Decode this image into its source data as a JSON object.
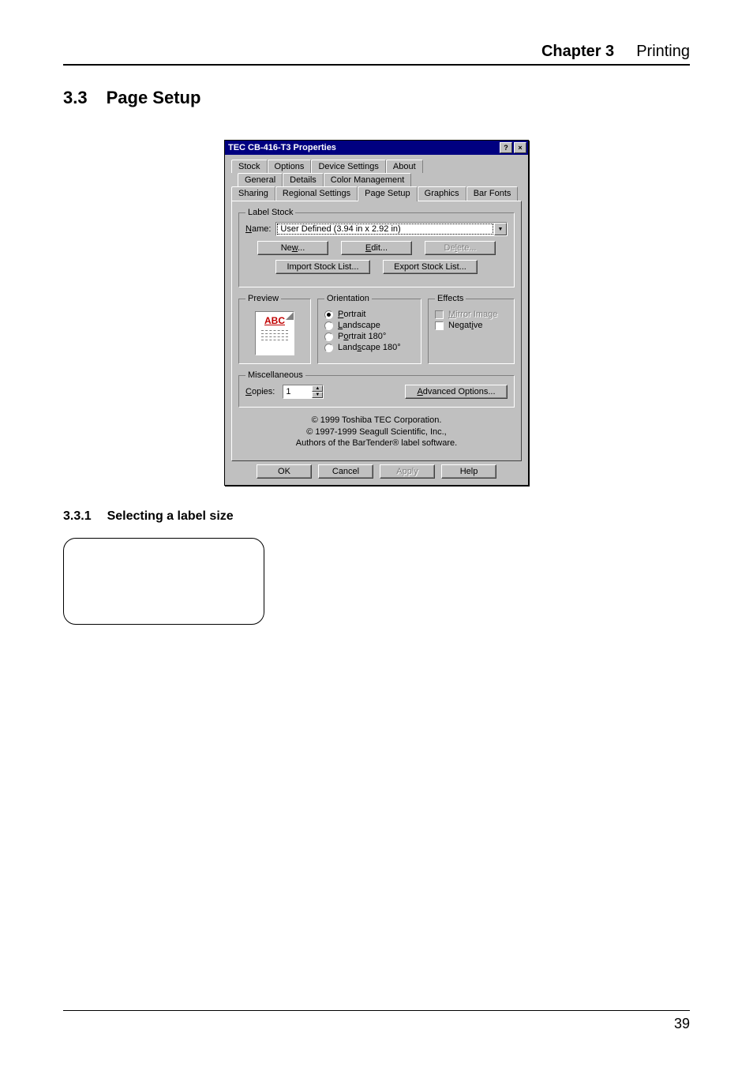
{
  "header": {
    "chapter": "Chapter 3",
    "subject": "Printing"
  },
  "section": {
    "number": "3.3",
    "title": "Page Setup"
  },
  "dialog": {
    "title": "TEC CB-416-T3 Properties",
    "help_glyph": "?",
    "close_glyph": "×",
    "tabs": {
      "row1": [
        "Stock",
        "Options",
        "Device Settings",
        "About"
      ],
      "row2": [
        "General",
        "Details",
        "Color Management"
      ],
      "row3": [
        "Sharing",
        "Regional Settings",
        "Page Setup",
        "Graphics",
        "Bar Fonts"
      ],
      "active": "Page Setup"
    },
    "label_stock": {
      "legend": "Label Stock",
      "name_label_pre": "N",
      "name_label_post": "ame:",
      "name_value": "User Defined (3.94 in x 2.92 in)",
      "new_btn_pre": "Ne",
      "new_btn_u": "w",
      "new_btn_post": "...",
      "edit_btn_u": "E",
      "edit_btn_post": "dit...",
      "delete_btn_pre": "De",
      "delete_btn_u": "l",
      "delete_btn_post": "ete...",
      "import_btn": "Import Stock List...",
      "export_btn": "Export Stock List..."
    },
    "preview": {
      "legend": "Preview",
      "abc": "ABC"
    },
    "orientation": {
      "legend": "Orientation",
      "portrait_u": "P",
      "portrait_post": "ortrait",
      "landscape_u": "L",
      "landscape_post": "andscape",
      "portrait180_pre": "P",
      "portrait180_u": "o",
      "portrait180_post": "rtrait 180°",
      "landscape180_pre": "Land",
      "landscape180_u": "s",
      "landscape180_post": "cape 180°"
    },
    "effects": {
      "legend": "Effects",
      "mirror_u": "M",
      "mirror_post": "irror Image",
      "negative_pre": "Negat",
      "negative_u": "i",
      "negative_post": "ve"
    },
    "misc": {
      "legend": "Miscellaneous",
      "copies_u": "C",
      "copies_post": "opies:",
      "copies_value": "1",
      "adv_u": "A",
      "adv_post": "dvanced Options..."
    },
    "copyright1": "© 1999 Toshiba TEC Corporation.",
    "copyright2a": "© 1997-1999 Seagull Scientific, Inc.,",
    "copyright2b": "Authors of the BarTender® label software.",
    "buttons": {
      "ok": "OK",
      "cancel": "Cancel",
      "apply": "Apply",
      "help": "Help"
    }
  },
  "subsection": {
    "number": "3.3.1",
    "title": "Selecting a label size"
  },
  "footer": {
    "page": "39"
  }
}
